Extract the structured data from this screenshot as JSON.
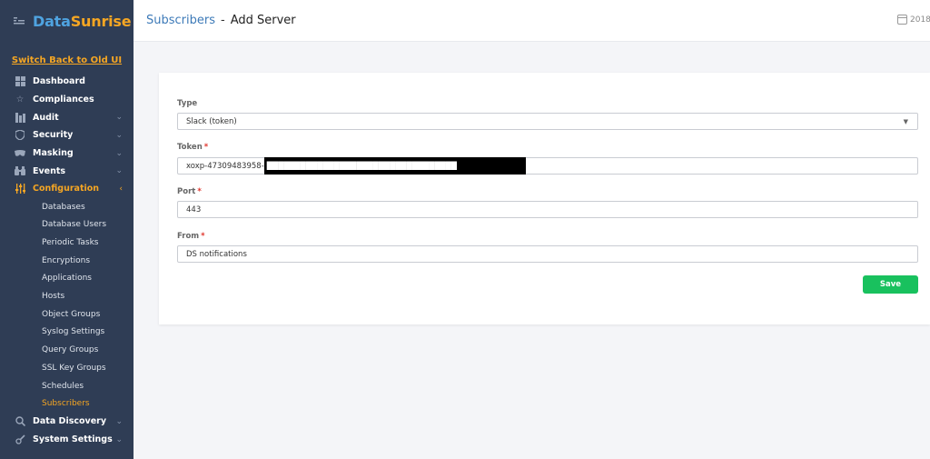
{
  "app": {
    "logo_part1": "Data",
    "logo_part2": "Sunrise",
    "switch_ui": "Switch Back to Old UI"
  },
  "sidebar": {
    "items": [
      {
        "label": "Dashboard",
        "icon": "dashboard-icon"
      },
      {
        "label": "Compliances",
        "icon": "star-icon"
      },
      {
        "label": "Audit",
        "icon": "audit-icon",
        "expandable": true
      },
      {
        "label": "Security",
        "icon": "shield-icon",
        "expandable": true
      },
      {
        "label": "Masking",
        "icon": "masking-icon",
        "expandable": true
      },
      {
        "label": "Events",
        "icon": "binoculars-icon",
        "expandable": true
      },
      {
        "label": "Configuration",
        "icon": "sliders-icon",
        "expandable": true,
        "active": true
      }
    ],
    "sub_items": [
      "Databases",
      "Database Users",
      "Periodic Tasks",
      "Encryptions",
      "Applications",
      "Hosts",
      "Object Groups",
      "Syslog Settings",
      "Query Groups",
      "SSL Key Groups",
      "Schedules",
      "Subscribers"
    ],
    "bottom_items": [
      {
        "label": "Data Discovery",
        "icon": "search-icon",
        "expandable": true
      },
      {
        "label": "System Settings",
        "icon": "wrench-icon",
        "expandable": true
      }
    ]
  },
  "header": {
    "breadcrumb_link": "Subscribers",
    "separator": "-",
    "current": "Add Server",
    "date": "2018-"
  },
  "form": {
    "type_label": "Type",
    "type_value": "Slack (token)",
    "token_label": "Token",
    "token_value_visible": "xoxp-47309483958-",
    "token_value_masked": "██████████████████████████████████",
    "port_label": "Port",
    "port_value": "443",
    "from_label": "From",
    "from_value": "DS notifications",
    "required_mark": "*",
    "save_label": "Save"
  },
  "colors": {
    "sidebar_bg": "#2f3d55",
    "accent_orange": "#f5a623",
    "link_blue": "#3d7ab8",
    "save_green": "#19c15e",
    "required_red": "#e0342c"
  }
}
